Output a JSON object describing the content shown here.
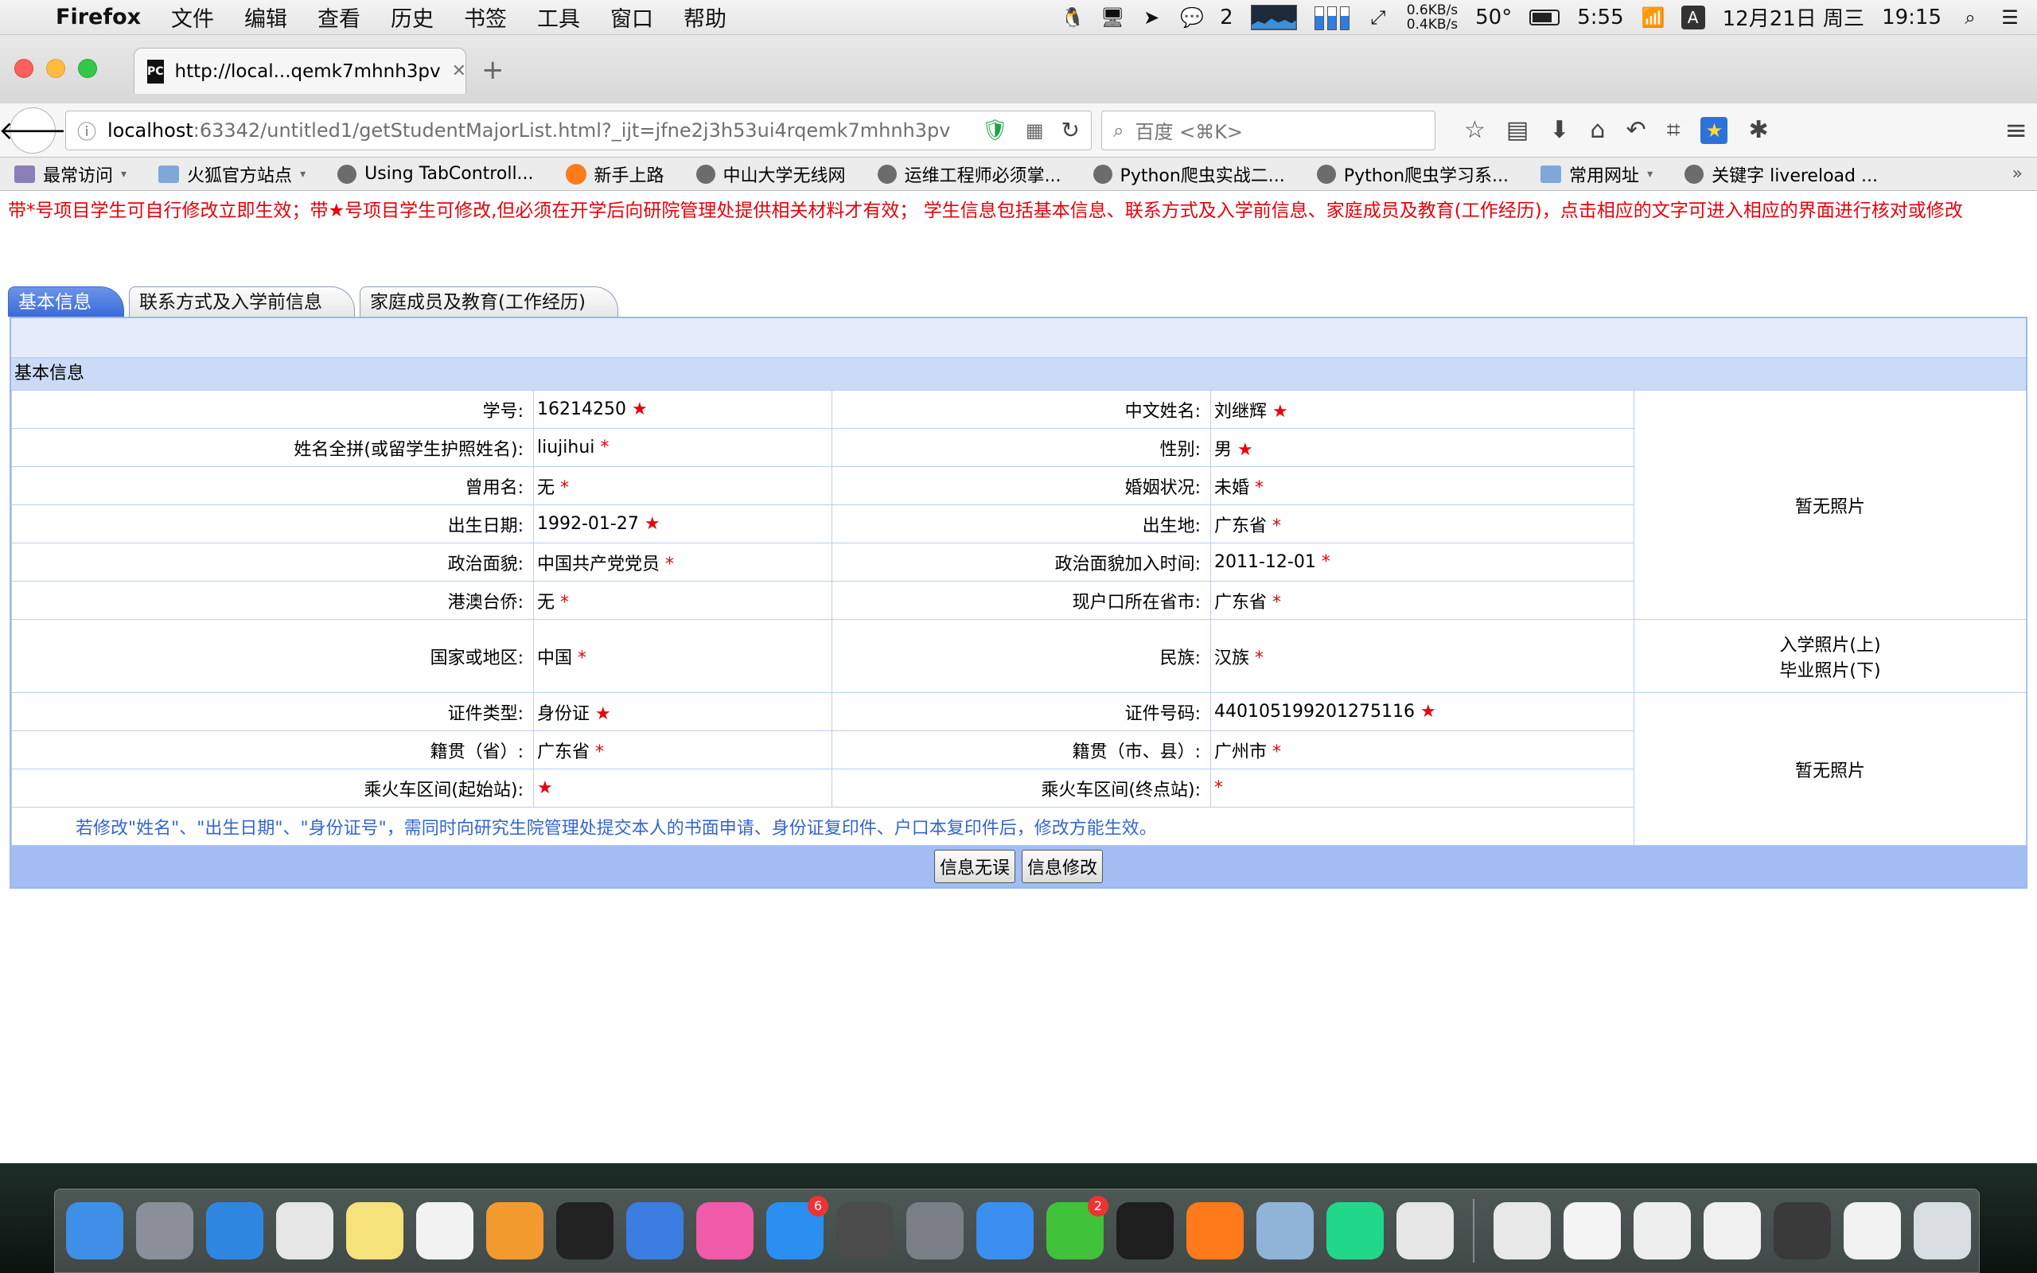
{
  "menubar": {
    "app_name": "Firefox",
    "menus": [
      "文件",
      "编辑",
      "查看",
      "历史",
      "书签",
      "工具",
      "窗口",
      "帮助"
    ],
    "wechat_count": "2",
    "net_up": "0.6KB/s",
    "net_down": "0.4KB/s",
    "temperature": "50°",
    "battery_time": "5:55",
    "ime": "A",
    "date": "12月21日 周三",
    "time": "19:15"
  },
  "browser": {
    "tab_title": "http://local...qemk7mhnh3pv",
    "url_host": "localhost",
    "url_path": ":63342/untitled1/getStudentMajorList.html?_ijt=jfne2j3h53ui4rqemk7mhnh3pv",
    "search_placeholder": "百度 <⌘K>"
  },
  "bookmarks": [
    {
      "label": "最常访问",
      "icon": "star-folder-icon",
      "dropdown": true
    },
    {
      "label": "火狐官方站点",
      "icon": "folder-icon",
      "dropdown": true
    },
    {
      "label": "Using TabControll...",
      "icon": "globe-icon",
      "dropdown": false
    },
    {
      "label": "新手上路",
      "icon": "firefox-icon",
      "dropdown": false
    },
    {
      "label": "中山大学无线网",
      "icon": "globe-icon",
      "dropdown": false
    },
    {
      "label": "运维工程师必须掌...",
      "icon": "globe-icon",
      "dropdown": false
    },
    {
      "label": "Python爬虫实战二...",
      "icon": "globe-icon",
      "dropdown": false
    },
    {
      "label": "Python爬虫学习系...",
      "icon": "globe-icon",
      "dropdown": false
    },
    {
      "label": "常用网址",
      "icon": "folder-icon",
      "dropdown": true
    },
    {
      "label": "关键字 livereload ...",
      "icon": "globe-icon",
      "dropdown": false
    }
  ],
  "page": {
    "notice": "带*号项目学生可自行修改立即生效；带★号项目学生可修改,但必须在开学后向研院管理处提供相关材料才有效；  学生信息包括基本信息、联系方式及入学前信息、家庭成员及教育(工作经历)，点击相应的文字可进入相应的界面进行核对或修改",
    "tabs": [
      "基本信息",
      "联系方式及入学前信息",
      "家庭成员及教育(工作经历)"
    ],
    "section_title": "基本信息",
    "rows": [
      {
        "l1": "学号:",
        "v1": "16214250",
        "m1": "★",
        "l2": "中文姓名:",
        "v2": "刘继辉",
        "m2": "★"
      },
      {
        "l1": "姓名全拼(或留学生护照姓名):",
        "v1": "liujihui",
        "m1": "*",
        "l2": "性别:",
        "v2": "男",
        "m2": "★"
      },
      {
        "l1": "曾用名:",
        "v1": "无",
        "m1": "*",
        "l2": "婚姻状况:",
        "v2": "未婚",
        "m2": "*"
      },
      {
        "l1": "出生日期:",
        "v1": "1992-01-27",
        "m1": "★",
        "l2": "出生地:",
        "v2": "广东省",
        "m2": "*"
      },
      {
        "l1": "政治面貌:",
        "v1": "中国共产党党员",
        "m1": "*",
        "l2": "政治面貌加入时间:",
        "v2": "2011-12-01",
        "m2": "*"
      },
      {
        "l1": "港澳台侨:",
        "v1": "无",
        "m1": "*",
        "l2": "现户口所在省市:",
        "v2": "广东省",
        "m2": "*"
      },
      {
        "l1": "国家或地区:",
        "v1": "中国",
        "m1": "*",
        "l2": "民族:",
        "v2": "汉族",
        "m2": "*"
      },
      {
        "l1": "证件类型:",
        "v1": "身份证",
        "m1": "★",
        "l2": "证件号码:",
        "v2": "440105199201275116",
        "m2": "★"
      },
      {
        "l1": "籍贯（省）:",
        "v1": "广东省",
        "m1": "*",
        "l2": "籍贯（市、县）:",
        "v2": "广州市",
        "m2": "*"
      },
      {
        "l1": "乘火车区间(起始站):",
        "v1": "",
        "m1": "★",
        "l2": "乘火车区间(终点站):",
        "v2": "",
        "m2": "*"
      }
    ],
    "photo_top": "暂无照片",
    "photo_caption_1": "入学照片(上)",
    "photo_caption_2": "毕业照片(下)",
    "photo_bottom": "暂无照片",
    "note": "若修改\"姓名\"、\"出生日期\"、\"身份证号\"，需同时向研究生院管理处提交本人的书面申请、身份证复印件、户口本复印件后，修改方能生效。",
    "btn_confirm": "信息无误",
    "btn_modify": "信息修改"
  },
  "dock": {
    "apps": [
      {
        "name": "finder",
        "color": "#3f8ee8"
      },
      {
        "name": "launchpad",
        "color": "#8a8f99"
      },
      {
        "name": "safari",
        "color": "#2f86e0"
      },
      {
        "name": "chrome",
        "color": "#e6e6e6"
      },
      {
        "name": "notes",
        "color": "#f6e27a"
      },
      {
        "name": "reminders",
        "color": "#f2f2f2"
      },
      {
        "name": "pages",
        "color": "#f29a2e"
      },
      {
        "name": "qq",
        "color": "#222222"
      },
      {
        "name": "keynote",
        "color": "#3b7de0"
      },
      {
        "name": "itunes",
        "color": "#f05aa8"
      },
      {
        "name": "app-store",
        "color": "#2a8ff0",
        "badge": "6"
      },
      {
        "name": "sublime-text",
        "color": "#4b4b4b"
      },
      {
        "name": "system-preferences",
        "color": "#7b7f86"
      },
      {
        "name": "quicktime",
        "color": "#3b8ff0"
      },
      {
        "name": "wechat",
        "color": "#41c23b",
        "badge": "2"
      },
      {
        "name": "terminal",
        "color": "#1e1e1e"
      },
      {
        "name": "firefox",
        "color": "#ff7a1a"
      },
      {
        "name": "preview",
        "color": "#8fb4d8"
      },
      {
        "name": "pycharm",
        "color": "#21d789"
      },
      {
        "name": "chrome",
        "color": "#e6e6e6"
      }
    ],
    "windows": [
      {
        "name": "document-stack-1",
        "color": "#e8e8e8"
      },
      {
        "name": "window-thumb-1",
        "color": "#f4f4f4"
      },
      {
        "name": "window-thumb-2",
        "color": "#eeeeee"
      },
      {
        "name": "window-thumb-3",
        "color": "#f0f0f0"
      },
      {
        "name": "window-thumb-4",
        "color": "#3a3a3a"
      },
      {
        "name": "window-thumb-5",
        "color": "#f2f2f2"
      },
      {
        "name": "trash",
        "color": "#d8dde2"
      }
    ]
  }
}
